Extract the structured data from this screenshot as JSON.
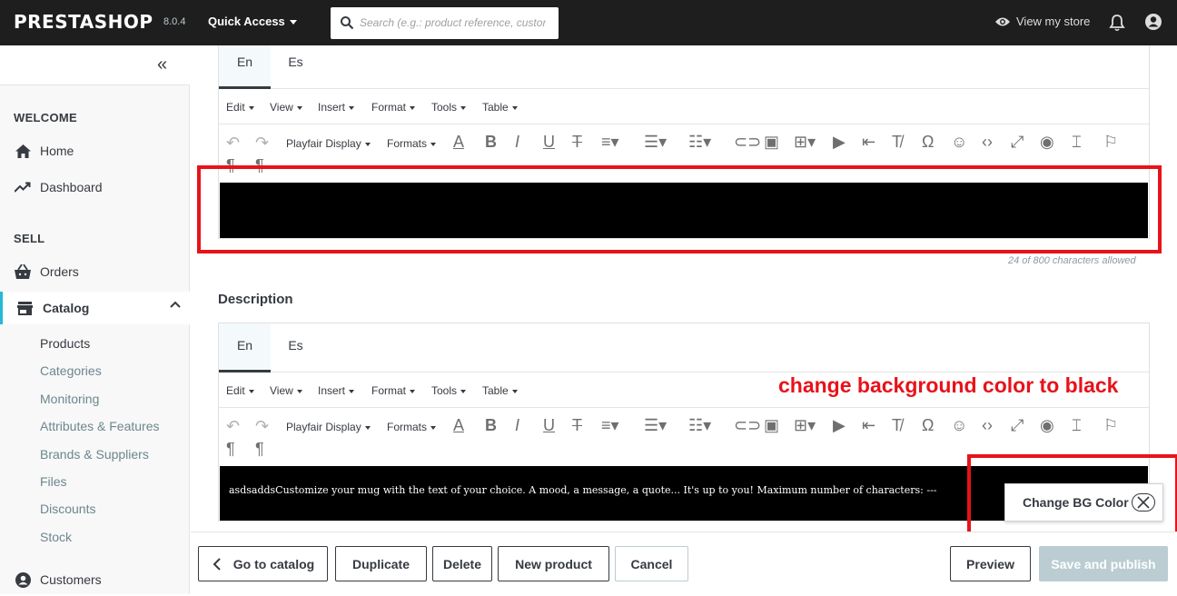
{
  "header": {
    "logo": "PRESTASHOP",
    "version": "8.0.4",
    "quick_access": "Quick Access",
    "search_placeholder": "Search (e.g.: product reference, custon",
    "view_store": "View my store"
  },
  "sidebar": {
    "collapse": "«",
    "welcome": "WELCOME",
    "home": "Home",
    "dashboard": "Dashboard",
    "sell": "SELL",
    "orders": "Orders",
    "catalog": "Catalog",
    "catalog_sub": [
      "Products",
      "Categories",
      "Monitoring",
      "Attributes & Features",
      "Brands & Suppliers",
      "Files",
      "Discounts",
      "Stock"
    ],
    "customers": "Customers"
  },
  "summary_editor": {
    "tabs": [
      "En",
      "Es"
    ],
    "menus": [
      "Edit",
      "View",
      "Insert",
      "Format",
      "Tools",
      "Table"
    ],
    "font": "Playfair Display",
    "formats": "Formats",
    "content": "",
    "char_count": "24 of 800 characters allowed"
  },
  "description": {
    "label": "Description",
    "tabs": [
      "En",
      "Es"
    ],
    "menus": [
      "Edit",
      "View",
      "Insert",
      "Format",
      "Tools",
      "Table"
    ],
    "font": "Playfair Display",
    "formats": "Formats",
    "content": "asdsaddsCustomize your mug with the text of your choice. A mood, a message, a quote... It's up to you! Maximum number of characters: ---"
  },
  "annotation": "change background color to black",
  "bg_button": "Change BG Color",
  "footer": {
    "go_to_catalog": "Go to catalog",
    "duplicate": "Duplicate",
    "delete": "Delete",
    "new_product": "New product",
    "cancel": "Cancel",
    "preview": "Preview",
    "save_publish": "Save and publish"
  },
  "colors": {
    "accent": "#25b9d7",
    "annotation": "#e8121a",
    "dark": "#363a41"
  }
}
